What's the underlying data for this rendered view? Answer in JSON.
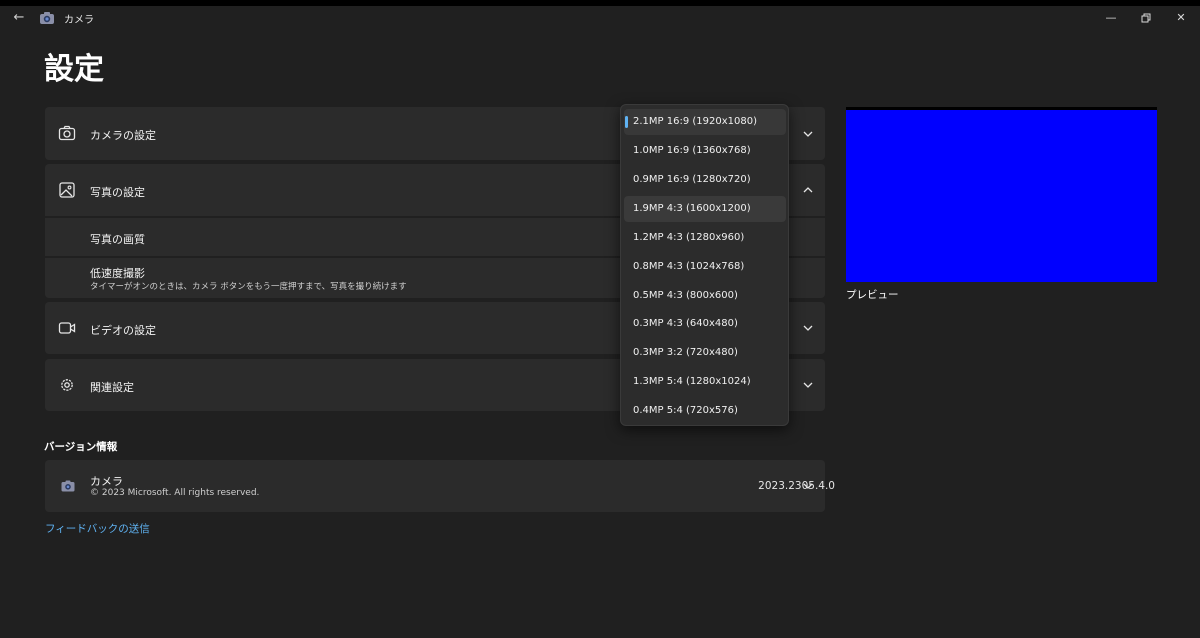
{
  "window": {
    "title": "カメラ",
    "back_icon": "back-arrow-icon",
    "app_icon": "camera-app-icon"
  },
  "page": {
    "title": "設定"
  },
  "settings": {
    "camera_settings": {
      "label": "カメラの設定",
      "icon": "camera-icon"
    },
    "photo_settings": {
      "label": "写真の設定",
      "icon": "image-icon",
      "expanded": true,
      "quality_label": "写真の画質",
      "timelapse_title": "低速度撮影",
      "timelapse_desc": "タイマーがオンのときは、カメラ ボタンをもう一度押すまで、写真を撮り続けます"
    },
    "video_settings": {
      "label": "ビデオの設定",
      "icon": "video-icon"
    },
    "related_settings": {
      "label": "関連設定",
      "icon": "gear-icon"
    }
  },
  "about": {
    "section_title": "バージョン情報",
    "app_name": "カメラ",
    "copyright": "© 2023 Microsoft. All rights reserved.",
    "version": "2023.2305.4.0"
  },
  "feedback_link": "フィードバックの送信",
  "preview": {
    "label": "プレビュー",
    "color": "#0000ff"
  },
  "resolution_dropdown": {
    "selected_index": 0,
    "hover_index": 3,
    "options": [
      "2.1MP 16:9 (1920x1080)",
      "1.0MP 16:9 (1360x768)",
      "0.9MP 16:9 (1280x720)",
      "1.9MP 4:3 (1600x1200)",
      "1.2MP 4:3 (1280x960)",
      "0.8MP 4:3 (1024x768)",
      "0.5MP 4:3 (800x600)",
      "0.3MP 4:3 (640x480)",
      "0.3MP 3:2 (720x480)",
      "1.3MP 5:4 (1280x1024)",
      "0.4MP 5:4 (720x576)"
    ]
  },
  "colors": {
    "background": "#202020",
    "card": "#2b2b2b",
    "accent": "#5fb2f2"
  }
}
